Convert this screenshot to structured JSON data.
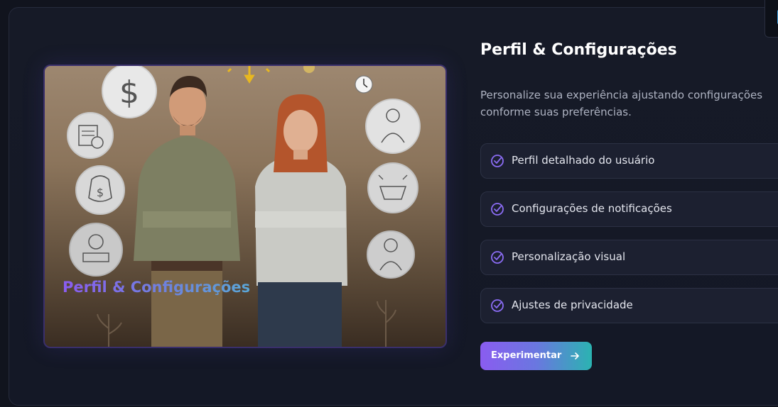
{
  "hero": {
    "title": "Perfil & Configurações",
    "description": "Personalize sua experiência ajustando configurações conforme suas preferências.",
    "image_caption": "Perfil & Configurações",
    "features": [
      {
        "label": "Perfil detalhado do usuário",
        "icon": "check-circle-icon"
      },
      {
        "label": "Configurações de notificações",
        "icon": "check-circle-icon"
      },
      {
        "label": "Personalização visual",
        "icon": "check-circle-icon"
      },
      {
        "label": "Ajustes de privacidade",
        "icon": "check-circle-icon"
      }
    ],
    "cta_label": "Experimentar",
    "cta_icon": "arrow-right-icon"
  },
  "colors": {
    "background": "#11141e",
    "card": "#161a27",
    "accent_purple": "#8a5cf0",
    "accent_teal": "#2bb3b1",
    "check_color": "#8b6cf4"
  }
}
